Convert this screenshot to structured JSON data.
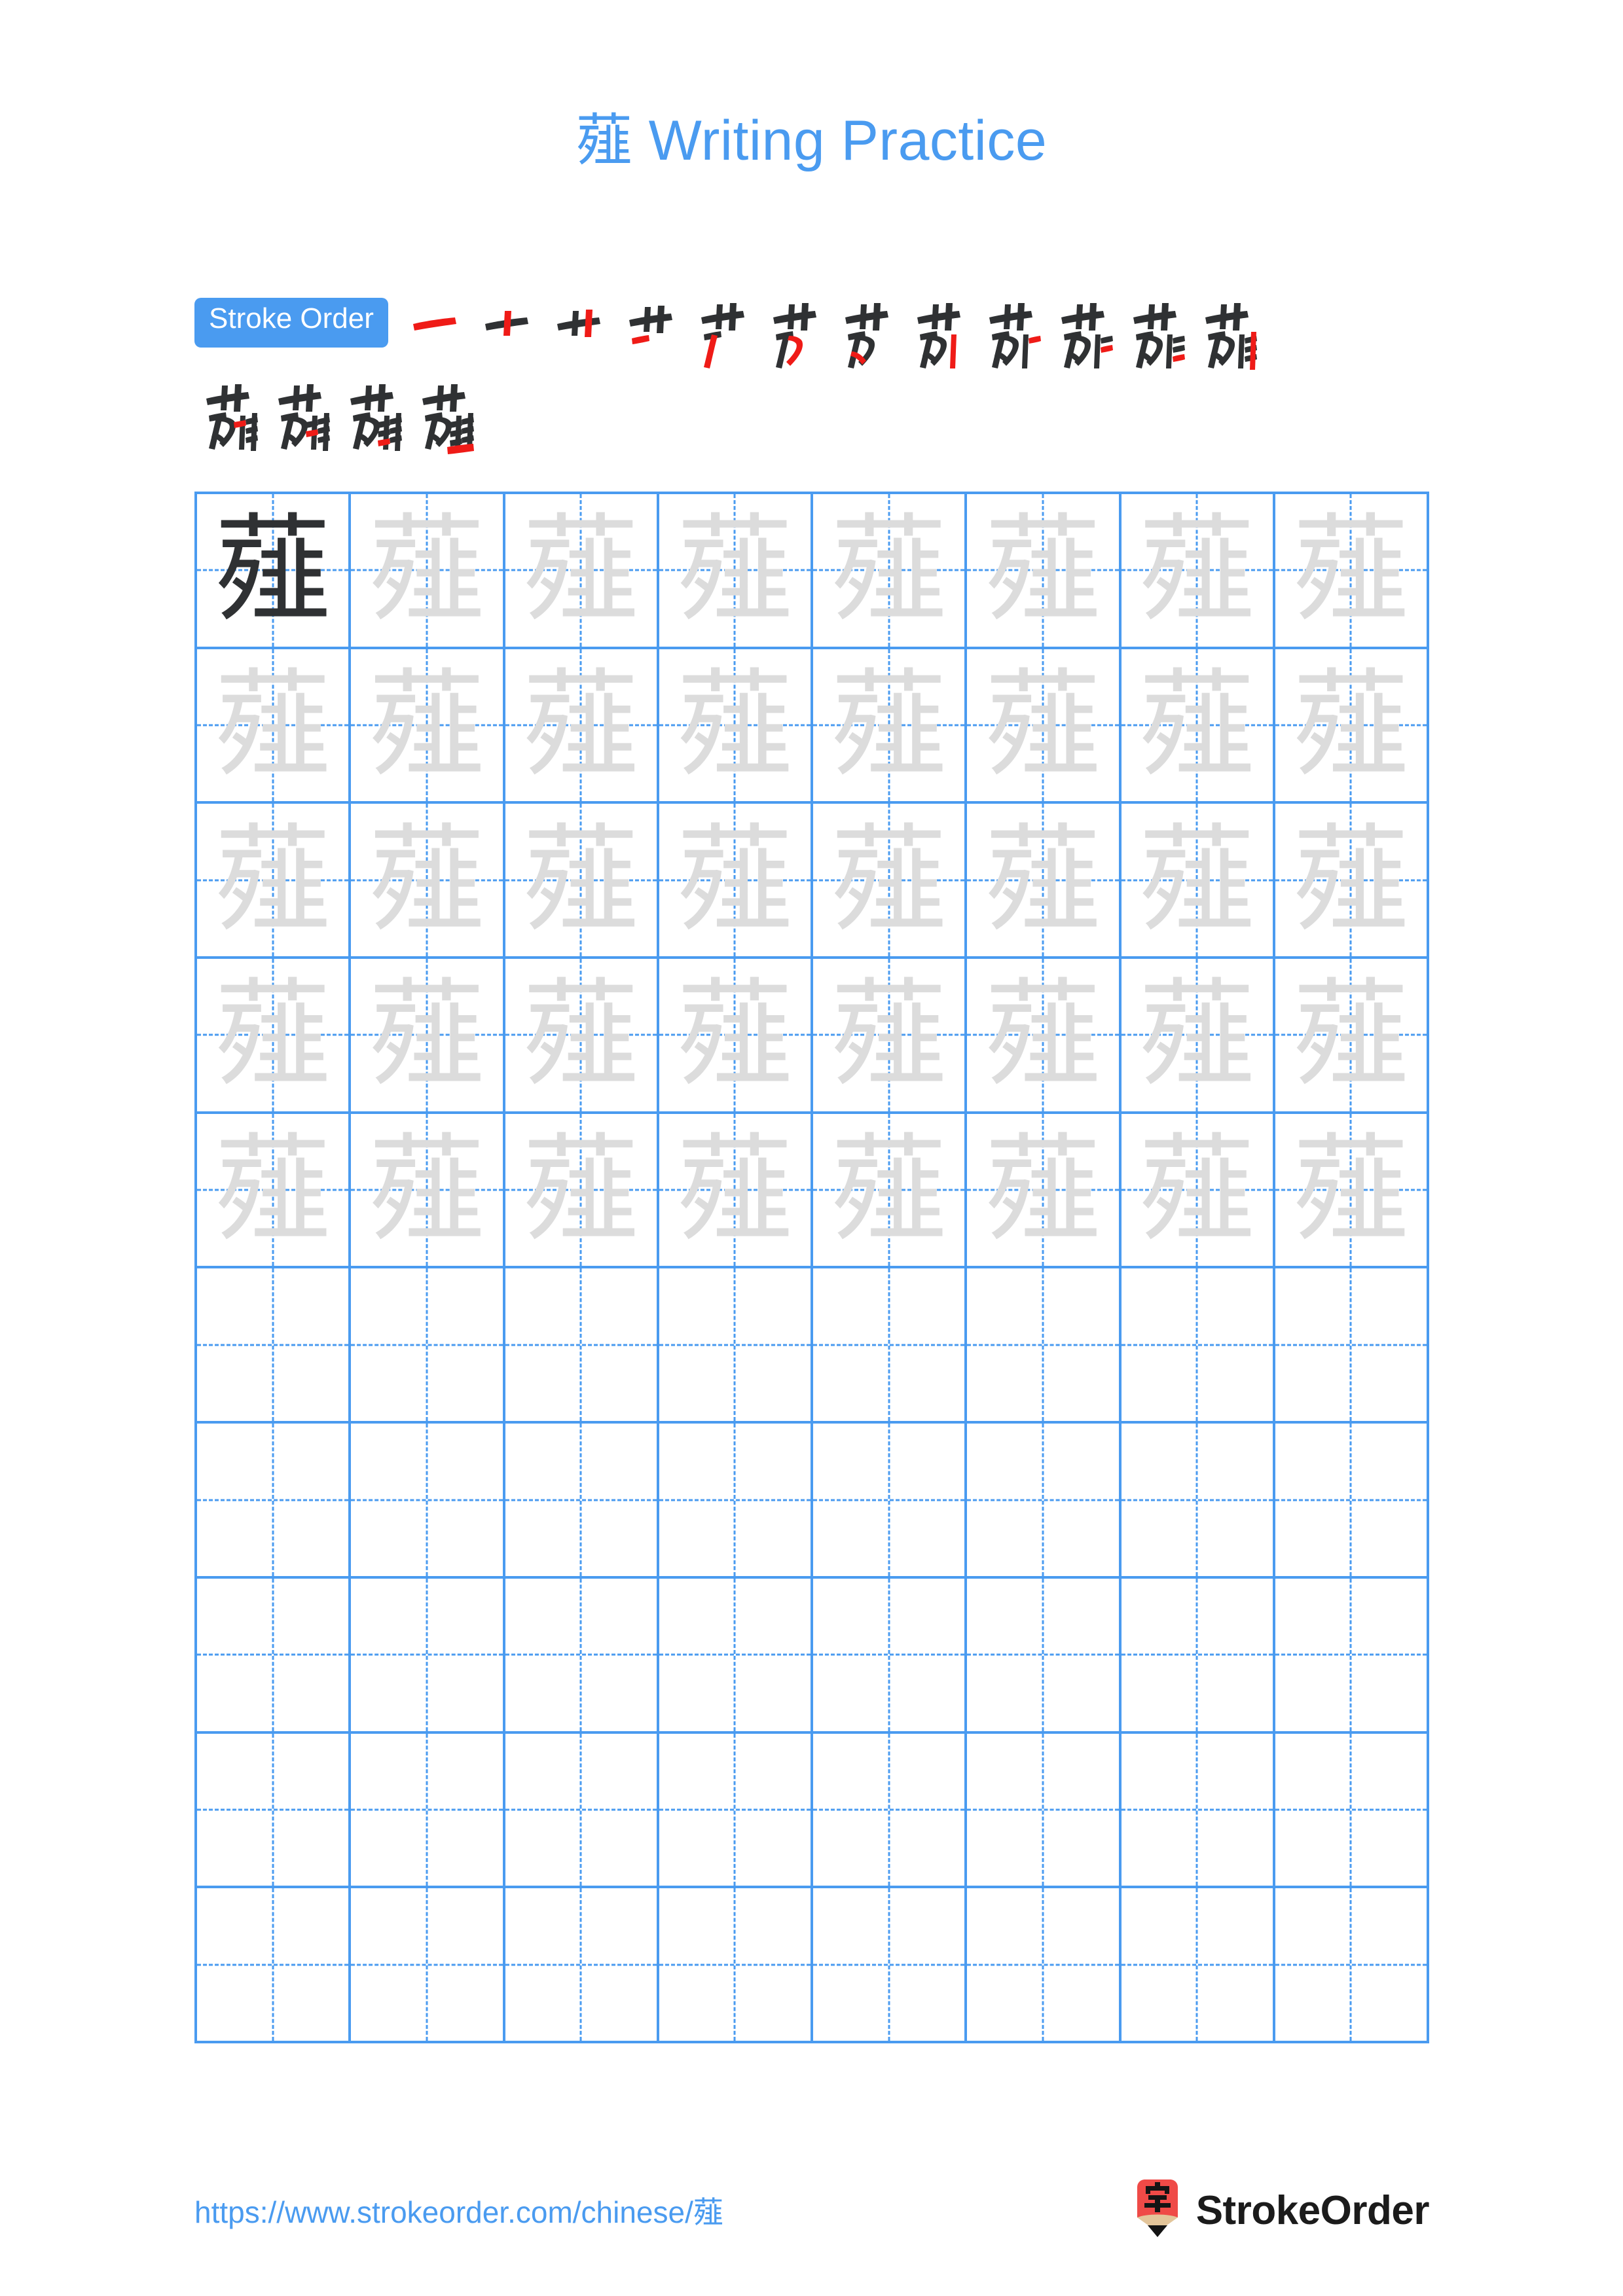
{
  "character": "薤",
  "title": {
    "char": "薤",
    "suffix": " Writing Practice",
    "full": "薤 Writing Practice",
    "color": "#4a9bf0"
  },
  "stroke_order": {
    "badge_label": "Stroke Order",
    "badge_bg": "#4a9bf0",
    "badge_text_color": "#ffffff",
    "total_strokes": 16,
    "done_color": "#2f3133",
    "new_color": "#ef1b17",
    "row1_count": 12,
    "row2_count": 4,
    "steps": [
      {
        "index": 1,
        "partial": "一"
      },
      {
        "index": 2,
        "partial": "十"
      },
      {
        "index": 3,
        "partial": "艹"
      },
      {
        "index": 4,
        "partial": "艹"
      },
      {
        "index": 5,
        "partial": "芦"
      },
      {
        "index": 6,
        "partial": "芀"
      },
      {
        "index": 7,
        "partial": "芀"
      },
      {
        "index": 8,
        "partial": "苅"
      },
      {
        "index": 9,
        "partial": "苅"
      },
      {
        "index": 10,
        "partial": "菂"
      },
      {
        "index": 11,
        "partial": "萈"
      },
      {
        "index": 12,
        "partial": "菲"
      },
      {
        "index": 13,
        "partial": "萉"
      },
      {
        "index": 14,
        "partial": "萉"
      },
      {
        "index": 15,
        "partial": "薤"
      },
      {
        "index": 16,
        "partial": "薤"
      }
    ]
  },
  "grid": {
    "columns": 8,
    "rows": 10,
    "border_color": "#4a9bf0",
    "guide_color": "#4a9bf0",
    "model_char_color": "#2f3133",
    "trace_char_color": "#dcdcdc",
    "cells": [
      [
        "model",
        "trace",
        "trace",
        "trace",
        "trace",
        "trace",
        "trace",
        "trace"
      ],
      [
        "trace",
        "trace",
        "trace",
        "trace",
        "trace",
        "trace",
        "trace",
        "trace"
      ],
      [
        "trace",
        "trace",
        "trace",
        "trace",
        "trace",
        "trace",
        "trace",
        "trace"
      ],
      [
        "trace",
        "trace",
        "trace",
        "trace",
        "trace",
        "trace",
        "trace",
        "trace"
      ],
      [
        "trace",
        "trace",
        "trace",
        "trace",
        "trace",
        "trace",
        "trace",
        "trace"
      ],
      [
        "blank",
        "blank",
        "blank",
        "blank",
        "blank",
        "blank",
        "blank",
        "blank"
      ],
      [
        "blank",
        "blank",
        "blank",
        "blank",
        "blank",
        "blank",
        "blank",
        "blank"
      ],
      [
        "blank",
        "blank",
        "blank",
        "blank",
        "blank",
        "blank",
        "blank",
        "blank"
      ],
      [
        "blank",
        "blank",
        "blank",
        "blank",
        "blank",
        "blank",
        "blank",
        "blank"
      ],
      [
        "blank",
        "blank",
        "blank",
        "blank",
        "blank",
        "blank",
        "blank",
        "blank"
      ]
    ]
  },
  "footer": {
    "url": "https://www.strokeorder.com/chinese/薤",
    "url_color": "#4a9bf0",
    "brand_name": "StrokeOrder",
    "logo_char": "字",
    "logo_body_color": "#ef4a47",
    "logo_wood_color": "#e3c59a",
    "logo_tip_color": "#141414"
  }
}
